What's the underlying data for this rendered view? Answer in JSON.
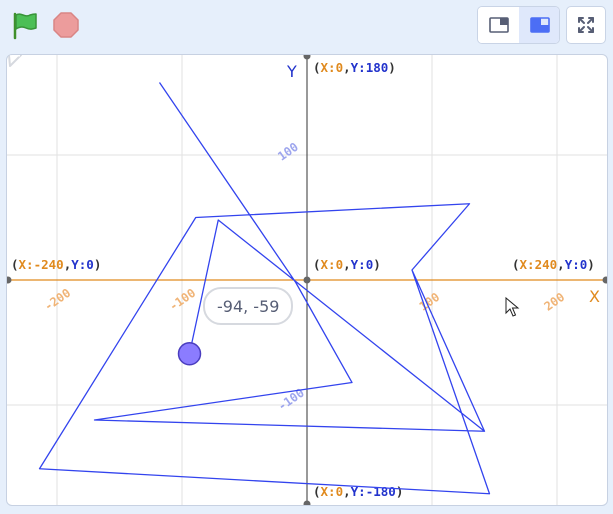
{
  "toolbar": {
    "green_flag_icon": "green-flag-icon",
    "stop_icon": "stop-sign-icon",
    "small_stage_icon": "small-stage-layout-icon",
    "large_stage_icon": "large-stage-layout-icon",
    "fullscreen_icon": "fullscreen-icon"
  },
  "stage": {
    "labels": {
      "y_axis": "Y",
      "x_axis": "X",
      "top": {
        "x_key": "X:",
        "x_val": "0",
        "sep": ",",
        "y_key": "Y:",
        "y_val": "180"
      },
      "bottom": {
        "x_key": "X:",
        "x_val": "0",
        "sep": ",",
        "y_key": "Y:",
        "y_val": "-180"
      },
      "left": {
        "x_key": "X:",
        "x_val": "-240",
        "sep": ",",
        "y_key": "Y:",
        "y_val": "0"
      },
      "right": {
        "x_key": "X:",
        "x_val": "240",
        "sep": ",",
        "y_key": "Y:",
        "y_val": "0"
      },
      "center": {
        "x_key": "X:",
        "x_val": "0",
        "sep": ",",
        "y_key": "Y:",
        "y_val": "0"
      }
    },
    "x_ticks": [
      "-200",
      "-100",
      "100",
      "200"
    ],
    "y_ticks": [
      "100",
      "-100"
    ],
    "speech_bubble": "-94, -59",
    "colors": {
      "axis_x": "#e08a1e",
      "axis_y": "#333333",
      "pen": "#3344ee",
      "sprite": "#8b7cff",
      "label_x_val": "#e08a1e",
      "label_y_val": "#2233cc",
      "grid": "#dddddd"
    },
    "pen_path": [
      [
        -118,
        158
      ],
      [
        -9,
        -2
      ],
      [
        36,
        -82
      ],
      [
        -170,
        -112
      ],
      [
        142,
        -121
      ],
      [
        84,
        8
      ],
      [
        130,
        61
      ],
      [
        -89,
        50
      ],
      [
        -214,
        -151
      ],
      [
        146,
        -171
      ],
      [
        84,
        8
      ],
      [
        142,
        -121
      ],
      [
        -71,
        48
      ],
      [
        -94,
        -59
      ]
    ],
    "sprite_position": [
      -94,
      -59
    ]
  }
}
